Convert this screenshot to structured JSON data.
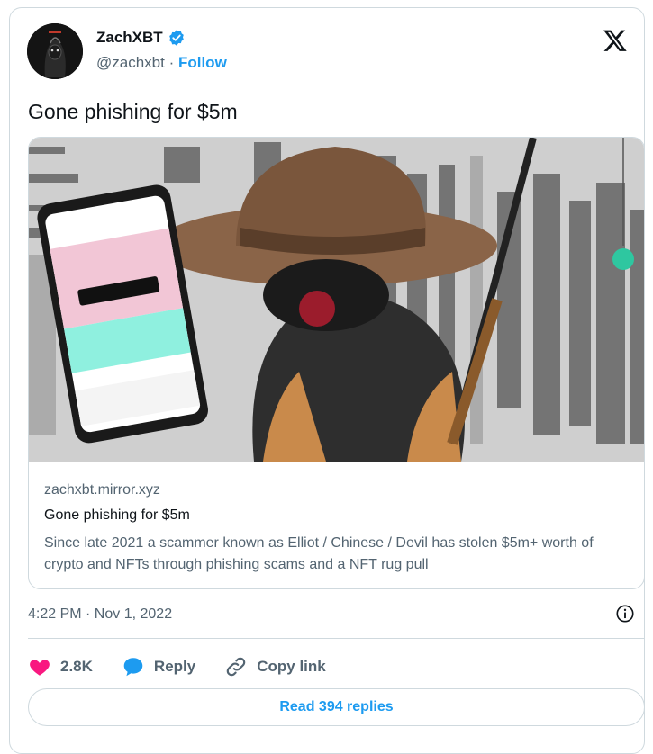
{
  "author": {
    "name": "ZachXBT",
    "handle": "@zachxbt",
    "separator": " · ",
    "follow_label": "Follow",
    "verified": true
  },
  "tweet": {
    "text": "Gone phishing for $5m",
    "timestamp": "4:22 PM · Nov 1, 2022"
  },
  "link_card": {
    "domain": "zachxbt.mirror.xyz",
    "title": "Gone phishing for $5m",
    "description": "Since late 2021 a scammer known as Elliot / Chinese / Devil has stolen $5m+ worth of crypto and NFTs through phishing scams and a NFT rug pull"
  },
  "actions": {
    "likes": "2.8K",
    "reply_label": "Reply",
    "copy_label": "Copy link",
    "read_replies_label": "Read 394 replies"
  },
  "colors": {
    "accent": "#1d9bf0",
    "like": "#f91880",
    "text": "#0f1419",
    "muted": "#536471",
    "border": "#cfd9de"
  }
}
